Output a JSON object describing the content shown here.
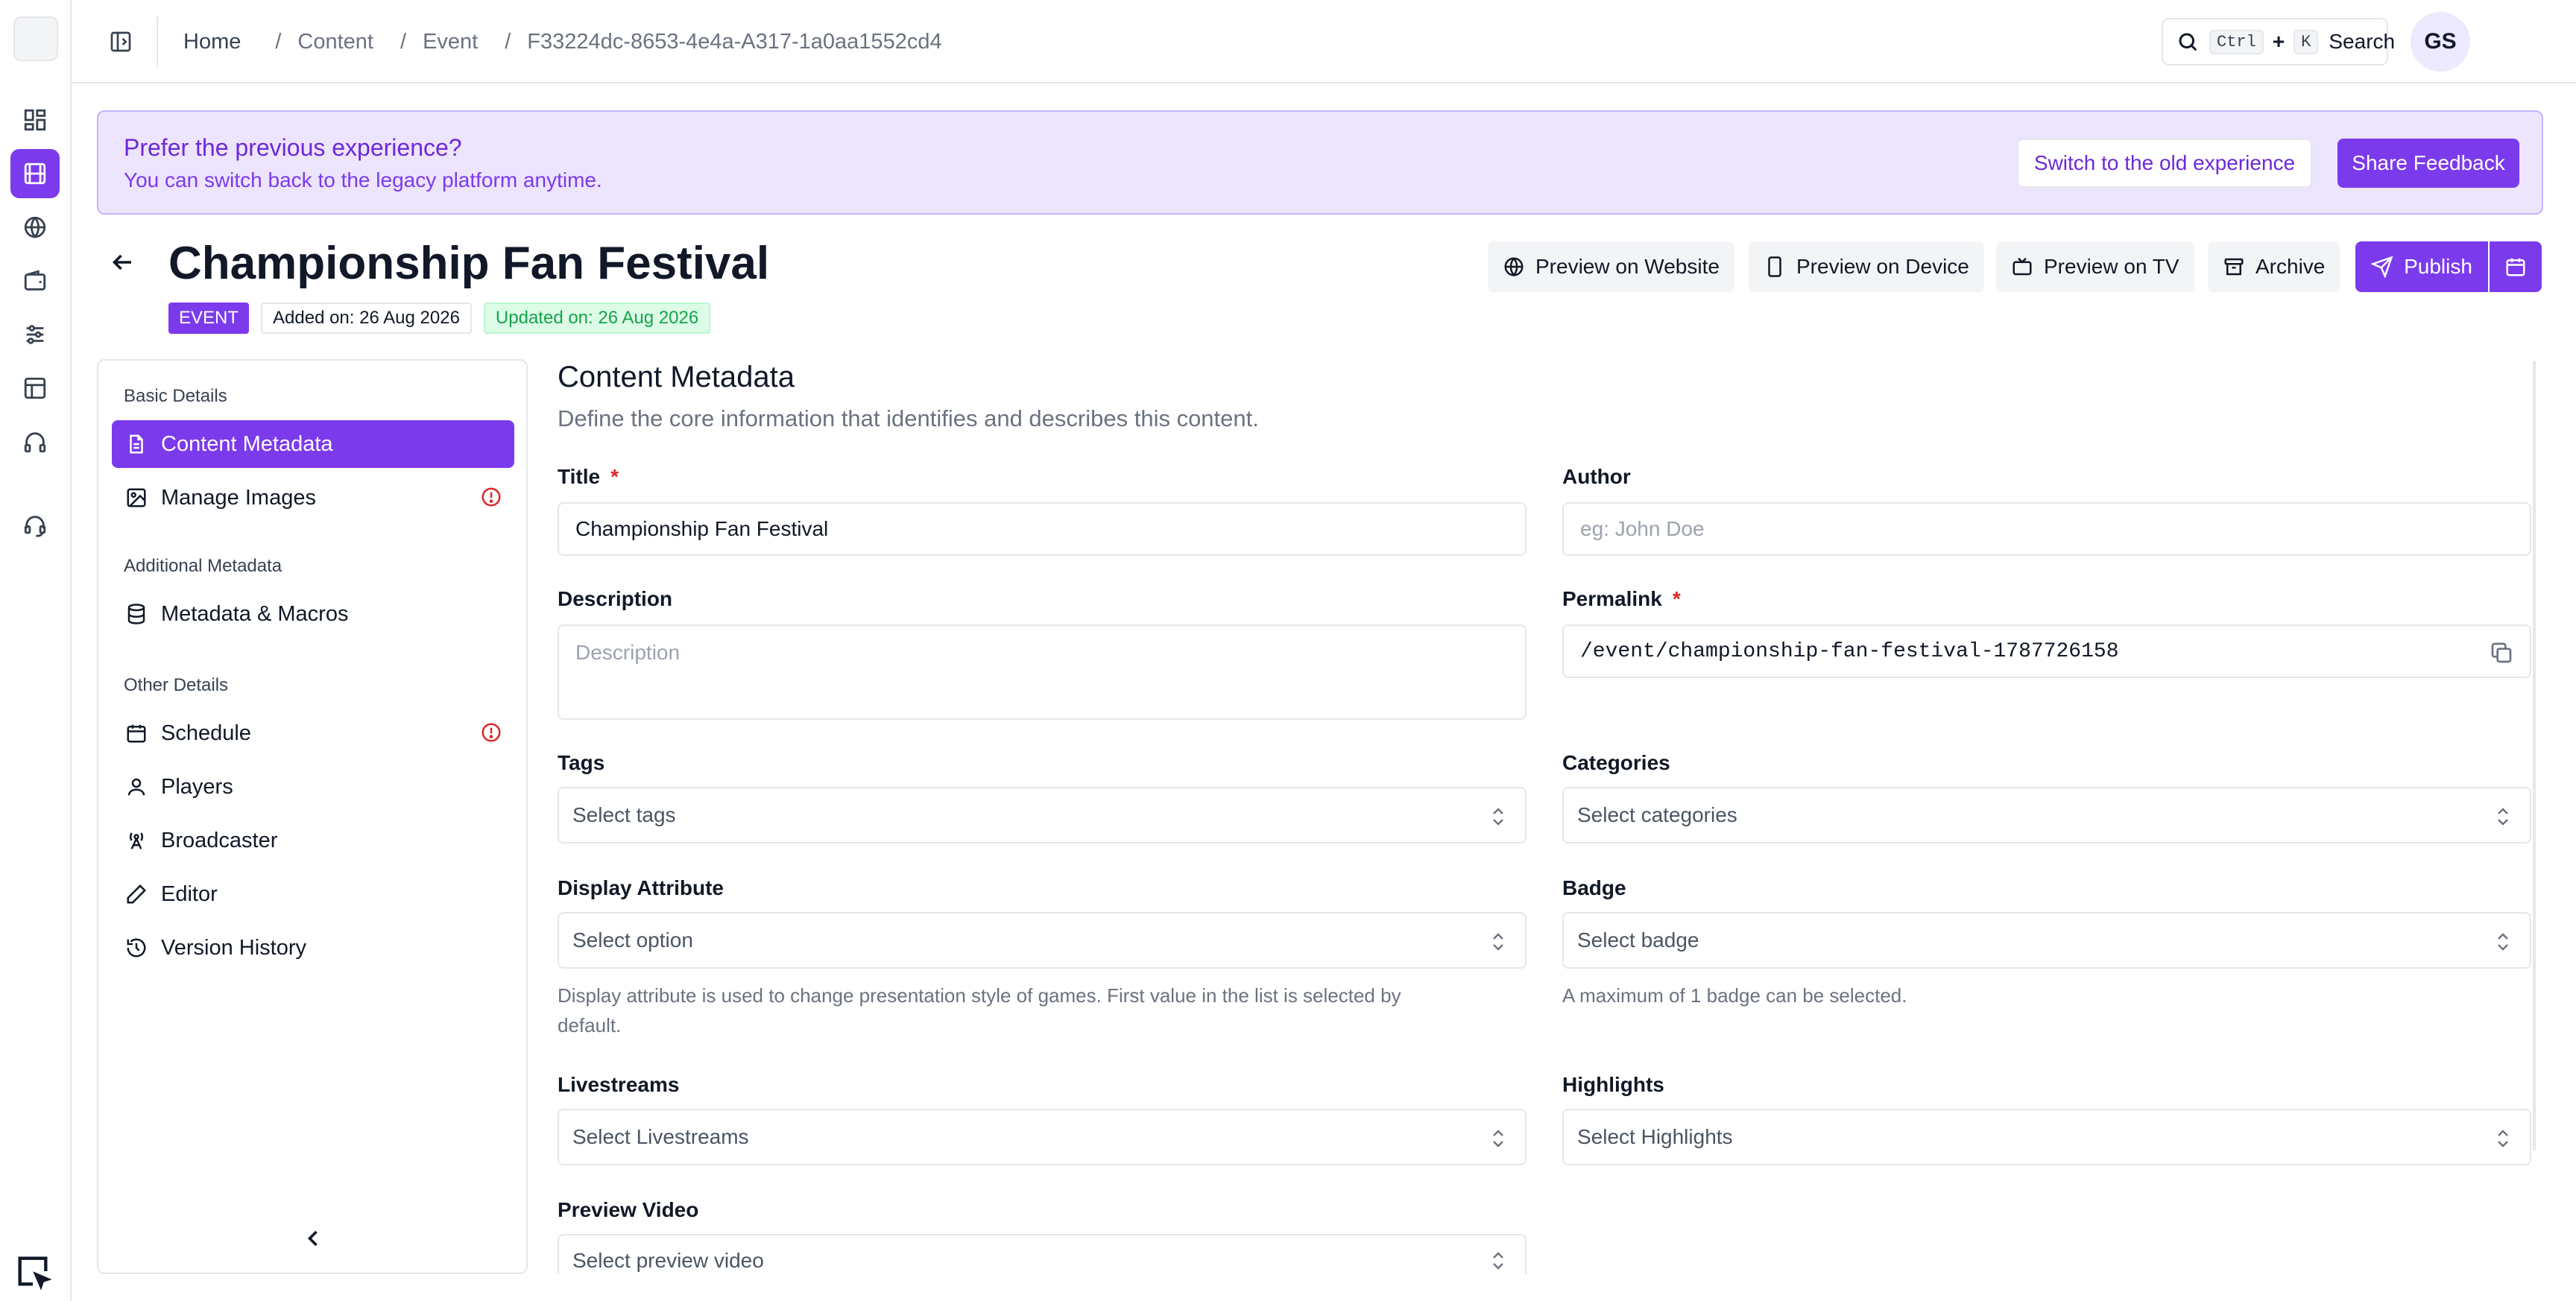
{
  "breadcrumb": {
    "home": "Home",
    "content": "Content",
    "event": "Event",
    "id": "F33224dc-8653-4e4a-A317-1a0aa1552cd4"
  },
  "search": {
    "key1": "Ctrl",
    "plus": "+",
    "key2": "K",
    "label": "Search"
  },
  "user": {
    "initials": "GS"
  },
  "banner": {
    "title": "Prefer the previous experience?",
    "subtitle": "You can switch back to the legacy platform anytime.",
    "switch_label": "Switch to the old experience",
    "feedback_label": "Share Feedback"
  },
  "page": {
    "title": "Championship Fan Festival",
    "type_badge": "EVENT",
    "added": "Added on: 26 Aug 2026",
    "updated": "Updated on: 26 Aug 2026"
  },
  "actions": {
    "preview_website": "Preview on Website",
    "preview_device": "Preview on Device",
    "preview_tv": "Preview on TV",
    "archive": "Archive",
    "publish": "Publish"
  },
  "sidenav": {
    "group_basic": "Basic Details",
    "content_metadata": "Content Metadata",
    "manage_images": "Manage Images",
    "group_additional": "Additional Metadata",
    "metadata_macros": "Metadata & Macros",
    "group_other": "Other Details",
    "schedule": "Schedule",
    "players": "Players",
    "broadcaster": "Broadcaster",
    "editor": "Editor",
    "version_history": "Version History"
  },
  "form": {
    "heading": "Content Metadata",
    "subheading": "Define the core information that identifies and describes this content.",
    "title_label": "Title",
    "required_mark": "*",
    "title_value": "Championship Fan Festival",
    "author_label": "Author",
    "author_placeholder": "eg: John Doe",
    "description_label": "Description",
    "description_placeholder": "Description",
    "permalink_label": "Permalink",
    "permalink_value": "/event/championship-fan-festival-1787726158",
    "tags_label": "Tags",
    "tags_placeholder": "Select tags",
    "categories_label": "Categories",
    "categories_placeholder": "Select categories",
    "display_attr_label": "Display Attribute",
    "display_attr_placeholder": "Select option",
    "display_attr_help_1": "Display attribute is used to change presentation style of games. First value in the list is selected by",
    "display_attr_help_2": "default.",
    "badge_label": "Badge",
    "badge_placeholder": "Select badge",
    "badge_help": "A maximum of 1 badge can be selected.",
    "livestreams_label": "Livestreams",
    "livestreams_placeholder": "Select Livestreams",
    "highlights_label": "Highlights",
    "highlights_placeholder": "Select Highlights",
    "preview_video_label": "Preview Video",
    "preview_video_placeholder": "Select preview video"
  },
  "colors": {
    "accent": "#7c3aed",
    "banner_bg": "#ede4fe",
    "danger": "#dc2626",
    "success": "#16a34a"
  }
}
